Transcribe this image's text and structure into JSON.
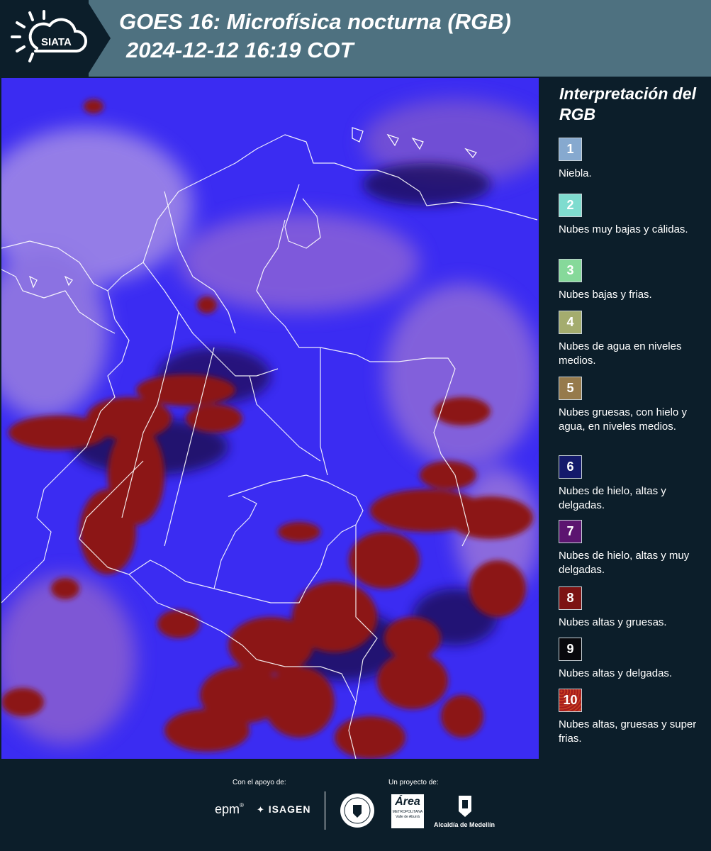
{
  "header": {
    "logo_text": "SIATA",
    "title_line1": "GOES 16: Microfísica nocturna (RGB)",
    "title_line2": "2024-12-12 16:19 COT"
  },
  "legend": {
    "title": "Interpretación del RGB",
    "items": [
      {
        "number": "1",
        "label": "Niebla.",
        "color": "#86a9cf"
      },
      {
        "number": "2",
        "label": "Nubes muy bajas y cálidas.",
        "color": "#7fdccf"
      },
      {
        "number": "3",
        "label": "Nubes bajas y frias.",
        "color": "#86d99a"
      },
      {
        "number": "4",
        "label": "Nubes de agua en niveles medios.",
        "color": "#a4ac6e"
      },
      {
        "number": "5",
        "label": "Nubes gruesas, con hielo y agua, en niveles medios.",
        "color": "#967a4c"
      },
      {
        "number": "6",
        "label": "Nubes de hielo, altas y delgadas.",
        "color": "#141a6b"
      },
      {
        "number": "7",
        "label": "Nubes de hielo, altas y muy delgadas.",
        "color": "#5c1570"
      },
      {
        "number": "8",
        "label": "Nubes altas y gruesas.",
        "color": "#7c1313"
      },
      {
        "number": "9",
        "label": "Nubes altas y delgadas.",
        "color": "#08080c"
      },
      {
        "number": "10",
        "label": "Nubes altas, gruesas y super frias.",
        "color": "#a61c1c"
      }
    ]
  },
  "footer": {
    "support_caption": "Con el apoyo de:",
    "project_caption": "Un proyecto de:",
    "sponsors": [
      "epm",
      "ISAGEN"
    ],
    "project_logos": [
      "Área Metropolitana Valle de Aburrá",
      "Alcaldía de Medellín"
    ],
    "epm_text": "epm",
    "isagen_text": "ISAGEN",
    "area_text": "Área",
    "area_sub1": "METROPOLITANA",
    "area_sub2": "Valle de Aburrá",
    "alcaldia_text": "Alcaldía de Medellín"
  },
  "map": {
    "product": "Microfísica nocturna (RGB)",
    "colors": {
      "base": "#3a2cf0",
      "purple_haze": "#8a4fd8",
      "thick_cloud": "#8a1010",
      "dark": "#170a4a",
      "border": "#ffffff"
    }
  }
}
